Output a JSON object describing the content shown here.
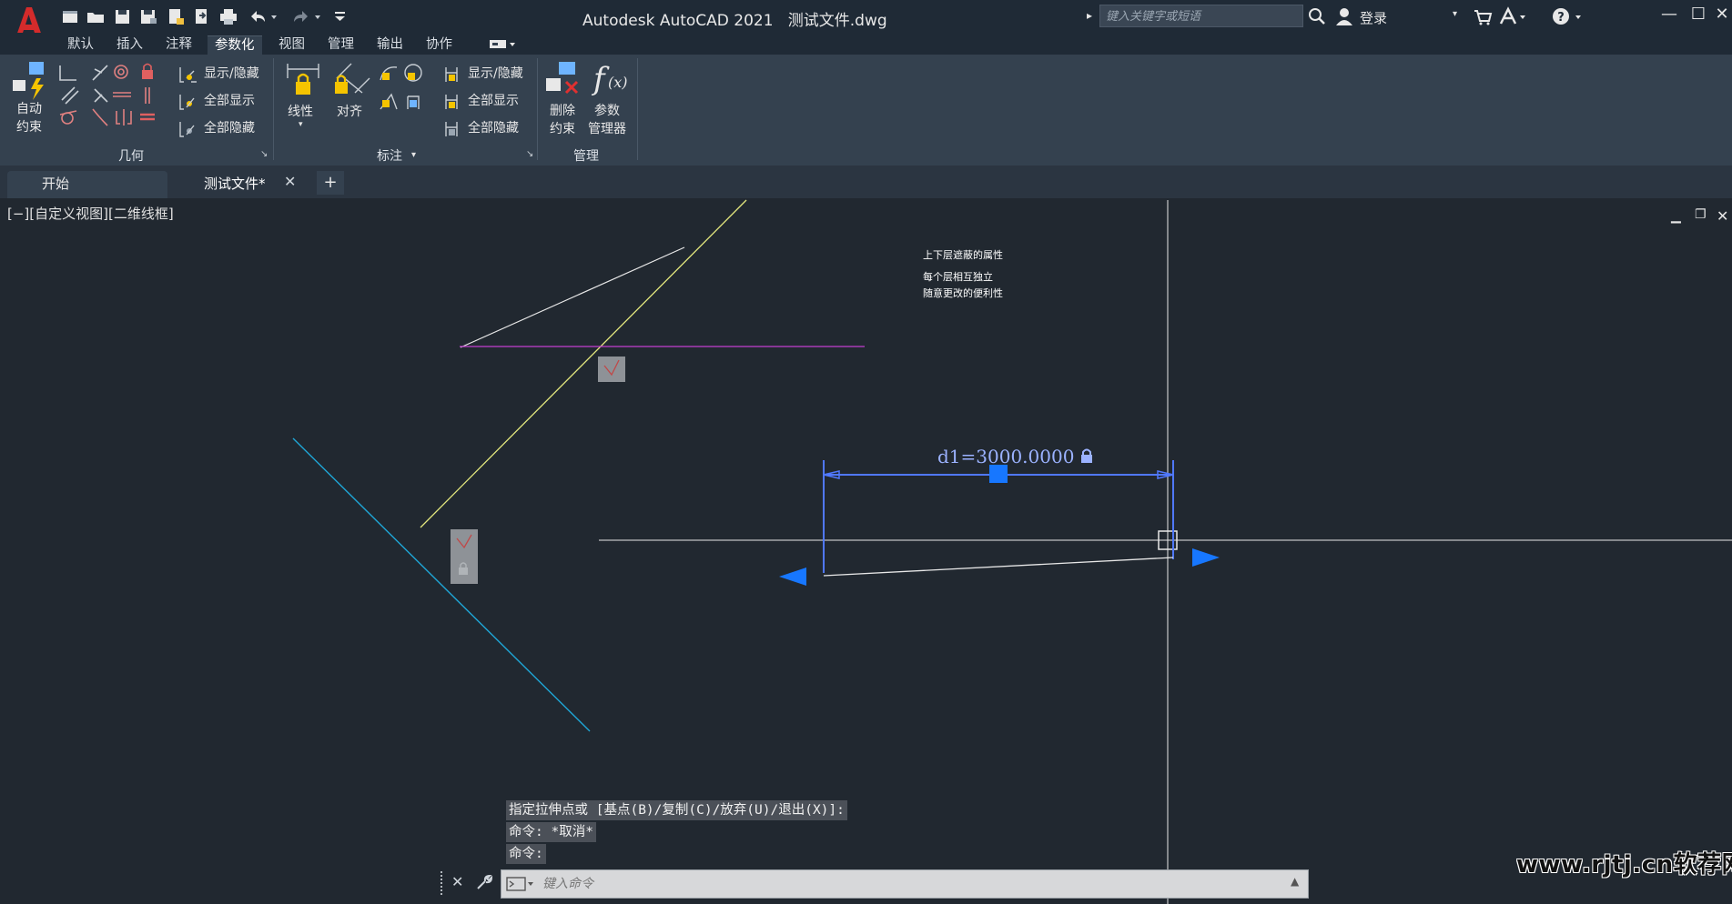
{
  "title_bar": {
    "app_name": "Autodesk AutoCAD 2021",
    "file_name": "测试文件.dwg",
    "search_placeholder": "键入关键字或短语",
    "login": "登录"
  },
  "menu_tabs": [
    "默认",
    "插入",
    "注释",
    "参数化",
    "视图",
    "管理",
    "输出",
    "协作"
  ],
  "active_menu_tab": "参数化",
  "ribbon": {
    "geometry": {
      "auto_constrain_line1": "自动",
      "auto_constrain_line2": "约束",
      "show_hide": "显示/隐藏",
      "show_all": "全部显示",
      "hide_all": "全部隐藏",
      "panel_title": "几何"
    },
    "dimensional": {
      "linear": "线性",
      "aligned": "对齐",
      "show_hide": "显示/隐藏",
      "show_all": "全部显示",
      "hide_all": "全部隐藏",
      "panel_title": "标注"
    },
    "manage": {
      "delete_line1": "删除",
      "delete_line2": "约束",
      "params_line1": "参数",
      "params_line2": "管理器",
      "panel_title": "管理"
    }
  },
  "file_tabs": [
    {
      "label": "开始",
      "active": false
    },
    {
      "label": "测试文件*",
      "active": true
    }
  ],
  "viewport_label": "[−][自定义视图][二维线框]",
  "annotations": [
    "上下层遮蔽的属性",
    "每个层相互独立",
    "随意更改的便利性"
  ],
  "dimension_text": "d1=3000.0000",
  "command_history": [
    "指定拉伸点或 [基点(B)/复制(C)/放弃(U)/退出(X)]:",
    "命令: *取消*",
    "命令:"
  ],
  "command_placeholder": "键入命令",
  "watermark": "www.rjtj.cn软荐网",
  "colors": {
    "background": "#212830",
    "ribbon": "#34414f",
    "logo_red": "#d42b2b",
    "line_yellow": "#e4e87e",
    "line_cyan": "#1fa6d6",
    "line_magenta": "#c23ecf",
    "grip_blue": "#1777ff",
    "dimension_blue": "#7d97ff"
  }
}
